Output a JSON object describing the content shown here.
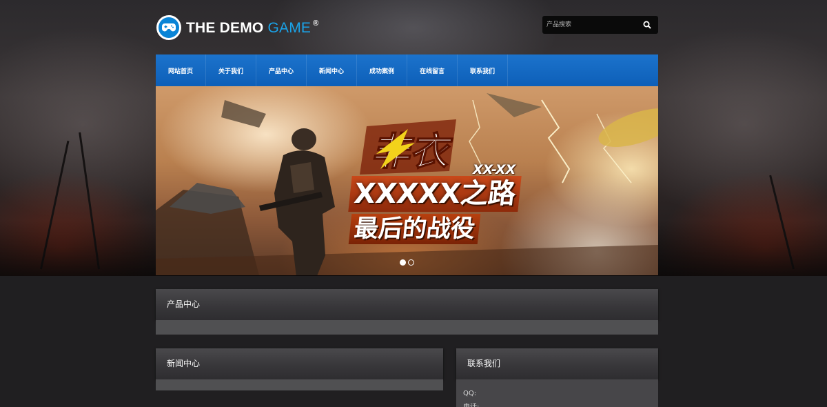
{
  "header": {
    "logo_main": "THE DEMO",
    "logo_accent": "GAME",
    "logo_reg": "®",
    "search": {
      "placeholder": "产品搜索"
    }
  },
  "nav": {
    "items": [
      "网站首页",
      "关于我们",
      "产品中心",
      "新闻中心",
      "成功案例",
      "在线留言",
      "联系我们"
    ]
  },
  "banner": {
    "badge_text": "非衣",
    "subtitle": "XX-XX",
    "line1": "XXXXX之路",
    "line2": "最后的战役",
    "slides": 2,
    "active_slide": 1
  },
  "sections": {
    "products_title": "产品中心",
    "news_title": "新闻中心",
    "contact_title": "联系我们",
    "contact_lines": [
      "QQ:",
      "电话:"
    ]
  },
  "colors": {
    "nav_blue": "#0d5fb8",
    "logo_blue": "#0a84d6",
    "accent_text": "#1aa3e8"
  }
}
